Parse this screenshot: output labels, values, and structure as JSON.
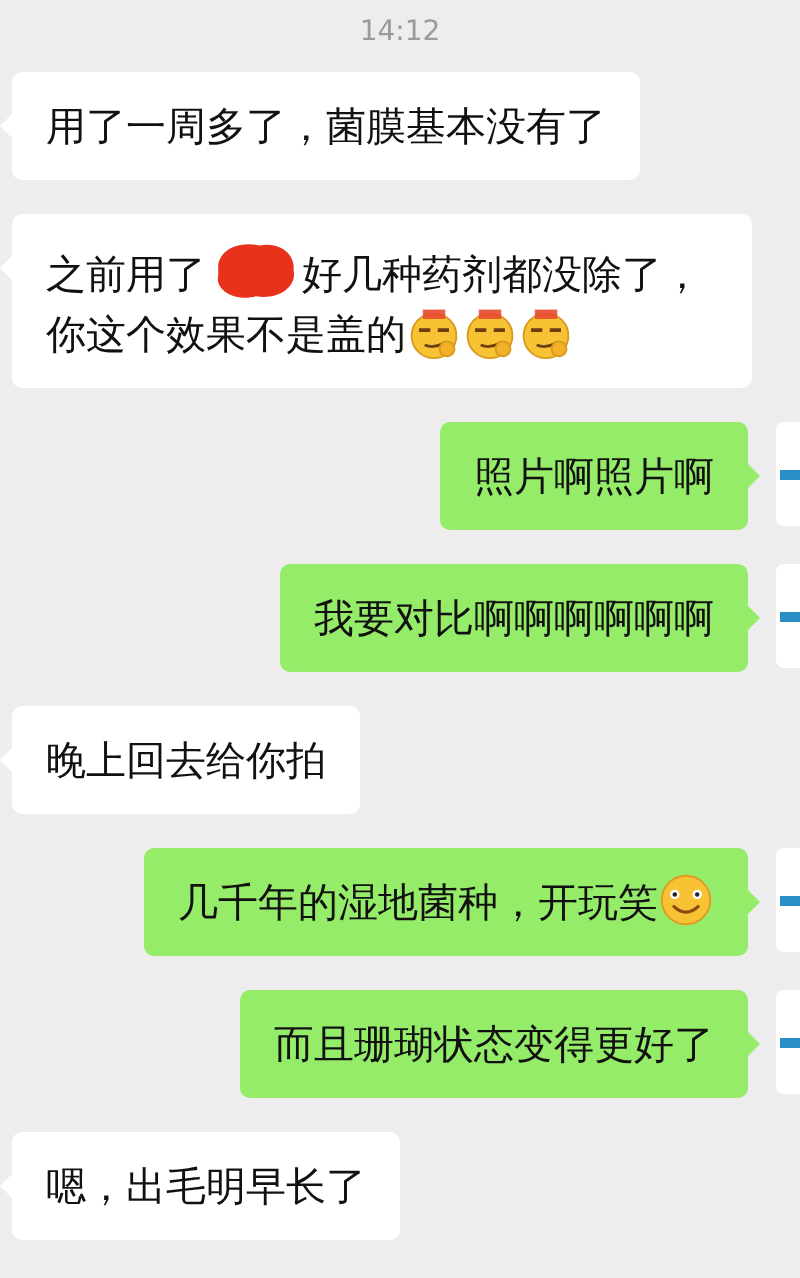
{
  "time": "14:12",
  "messages": [
    {
      "outgoing": false,
      "parts": [
        {
          "kind": "text",
          "text": "用了一周多了，菌膜基本没有了"
        }
      ]
    },
    {
      "outgoing": false,
      "parts": [
        {
          "kind": "text",
          "text": "之前用了"
        },
        {
          "kind": "redaction"
        },
        {
          "kind": "text",
          "text": "好几种药剂都没除了，你这个效果不是盖的"
        },
        {
          "kind": "smirk"
        },
        {
          "kind": "smirk"
        },
        {
          "kind": "smirk"
        }
      ]
    },
    {
      "outgoing": true,
      "parts": [
        {
          "kind": "text",
          "text": "照片啊照片啊"
        }
      ]
    },
    {
      "outgoing": true,
      "parts": [
        {
          "kind": "text",
          "text": "我要对比啊啊啊啊啊啊"
        }
      ]
    },
    {
      "outgoing": false,
      "parts": [
        {
          "kind": "text",
          "text": "晚上回去给你拍"
        }
      ]
    },
    {
      "outgoing": true,
      "parts": [
        {
          "kind": "text",
          "text": "几千年的湿地菌种，开玩笑"
        },
        {
          "kind": "grin"
        }
      ]
    },
    {
      "outgoing": true,
      "parts": [
        {
          "kind": "text",
          "text": "而且珊瑚状态变得更好了"
        }
      ]
    },
    {
      "outgoing": false,
      "parts": [
        {
          "kind": "text",
          "text": "嗯，出毛明早长了"
        }
      ]
    }
  ]
}
